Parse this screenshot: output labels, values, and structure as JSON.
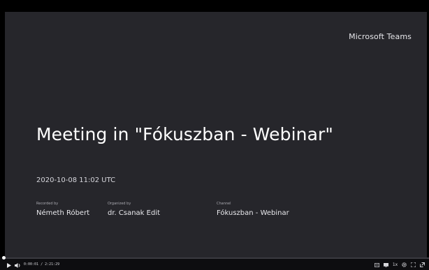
{
  "video": {
    "brand": "Microsoft Teams",
    "title": "Meeting in \"Fókuszban - Webinar\"",
    "datetime": "2020-10-08 11:02 UTC",
    "meta": [
      {
        "label": "Recorded by",
        "value": "Németh Róbert"
      },
      {
        "label": "Organized by",
        "value": "dr. Csanak Edit"
      },
      {
        "label": "Channel",
        "value": "Fókuszban - Webinar"
      }
    ]
  },
  "player": {
    "timecode": "0:00:01 / 2:21:29",
    "progress": 0.0,
    "controls_left": [
      "play-icon",
      "volume-icon"
    ],
    "controls_right": [
      "captions-icon",
      "screen-icon",
      "speed-icon",
      "settings-icon",
      "fullscreen-icon",
      "popout-icon"
    ],
    "speed_label": "1x",
    "colors": {
      "slide_bg": "#26262b",
      "bar_bg": "#0d0d10",
      "text": "#ffffff"
    }
  }
}
